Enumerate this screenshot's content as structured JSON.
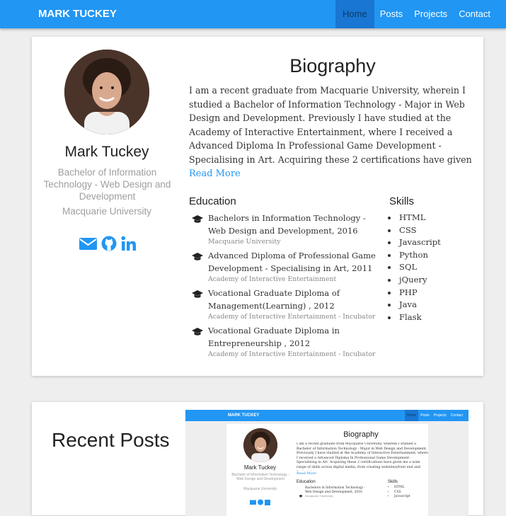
{
  "nav": {
    "brand": "MARK TUCKEY",
    "links": [
      "Home",
      "Posts",
      "Projects",
      "Contact"
    ],
    "active": "Home"
  },
  "profile": {
    "name": "Mark Tuckey",
    "degree": "Bachelor of Information Technology - Web Design and Development",
    "university": "Macquarie University",
    "social_icons": [
      "email-icon",
      "github-icon",
      "linkedin-icon"
    ]
  },
  "biography": {
    "title": "Biography",
    "text": "I am a recent graduate from Macquarie University, wherein I studied a Bachelor of Information Technology - Major in Web Design and Development. Previously I have studied at the Academy of Interactive Entertainment, where I received a Advanced Diploma In Professional Game Development - Specialising in Art. Acquiring these 2 certifications have given me a wide range of skills across",
    "read_more": "Read More"
  },
  "education": {
    "title": "Education",
    "items": [
      {
        "name": "Bachelors in Information Technology - Web Design and Development, 2016",
        "institution": "Macquarie University"
      },
      {
        "name": "Advanced Diploma of Professional Game Development - Specialising in Art, 2011",
        "institution": "Academy of Interactive Entertainment"
      },
      {
        "name": "Vocational Graduate Diploma of Management(Learning) , 2012",
        "institution": "Academy of Interactive Entertainment - Incubator"
      },
      {
        "name": "Vocational Graduate Diploma in Entrepreneurship , 2012",
        "institution": "Academy of Interactive Entertainment - Incubator"
      }
    ]
  },
  "skills": {
    "title": "Skills",
    "items": [
      "HTML",
      "CSS",
      "Javascript",
      "Python",
      "SQL",
      "jQuery",
      "PHP",
      "Java",
      "Flask"
    ]
  },
  "recent_posts": {
    "title": "Recent Posts",
    "preview": {
      "brand": "MARK TUCKEY",
      "links": [
        "Home",
        "Posts",
        "Projects",
        "Contact"
      ],
      "name": "Mark Tuckey",
      "degree": "Bachelor of Information Technology - Web Design and Development",
      "university": "Macquarie University",
      "bio_title": "Biography",
      "bio_text": "I am a recent graduate from Macquarie University, wherein I studied a Bachelor of Information Technology - Major in Web Design and Development. Previously I have studied at the Academy of Interactive Entertainment, where I received a Advanced Diploma In Professional Game Development - Specialising in Art. Acquiring these 2 certifications have given me a wide range of skills across digital media, from creating websites(front end and back end),",
      "read_more": "Read More",
      "edu_title": "Education",
      "edu_items": [
        {
          "name": "Bachelors in Information Technology - Web Design and Development, 2016",
          "institution": "Macquarie University"
        }
      ],
      "skills_title": "Skills",
      "skills": [
        "HTML",
        "CSS",
        "Javascript"
      ]
    }
  },
  "colors": {
    "accent": "#2196f3",
    "nav_active": "#1976d2",
    "muted": "#9e9e9e",
    "background": "#eeeeee"
  }
}
